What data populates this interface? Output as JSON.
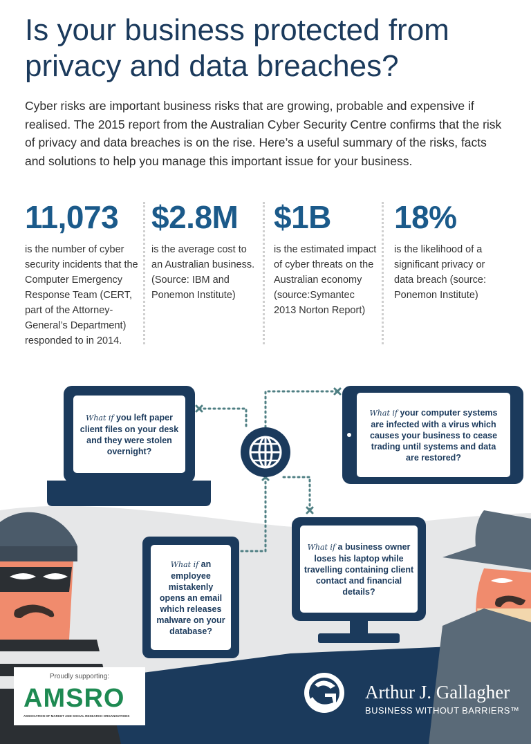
{
  "title": "Is your business protected from privacy and data breaches?",
  "intro": "Cyber risks are important business risks that are growing, probable and expensive if realised. The 2015 report from the Australian Cyber Security Centre confirms that the risk of privacy and data breaches is on the rise. Here’s a useful summary of the risks, facts and solutions to help you manage this important issue for your business.",
  "stats": [
    {
      "value": "11,073",
      "desc": "is the number of cyber security incidents that the Computer Emergency Response Team (CERT, part of the Attorney-General’s Department) responded to in 2014."
    },
    {
      "value": "$2.8M",
      "desc": "is the average cost to an Australian business. (Source: IBM and Ponemon Institute)"
    },
    {
      "value": "$1B",
      "desc": "is the estimated impact of cyber threats on the Australian economy (source:Symantec 2013 Norton Report)"
    },
    {
      "value": "18%",
      "desc": "is the likelihood of a significant privacy or data breach (source: Ponemon Institute)"
    }
  ],
  "scenarios": {
    "laptop": {
      "lead": "What if",
      "text": "you left paper client files on your desk and they were stolen overnight?"
    },
    "tablet": {
      "lead": "What if",
      "text": "your computer systems are infected with a virus which causes your business to cease trading until systems and data are restored?"
    },
    "phone": {
      "lead": "What if",
      "text": "an employee mistakenly opens an email which releases malware on your database?"
    },
    "monitor": {
      "lead": "What if",
      "text": "a business owner loses his laptop while travelling containing client contact and financial details?"
    }
  },
  "footer": {
    "supporting": "Proudly supporting:",
    "amsro": "AMSRO",
    "amsro_full": "ASSOCIATION OF MARKET AND SOCIAL RESEARCH ORGANISATIONS",
    "brand": "Arthur J. Gallagher",
    "tagline": "BUSINESS WITHOUT BARRIERS™"
  },
  "colors": {
    "navy": "#1b3a5c",
    "blue": "#1b5a8a",
    "teal": "#4f7f83",
    "green": "#1e8a52"
  },
  "icons": [
    "globe-icon",
    "burglar-figure",
    "spy-figure",
    "gallagher-logo-icon"
  ]
}
